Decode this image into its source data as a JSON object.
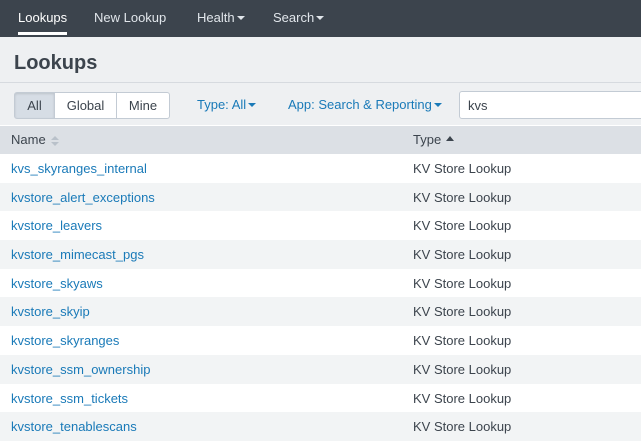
{
  "nav": {
    "items": [
      {
        "label": "Lookups"
      },
      {
        "label": "New Lookup"
      },
      {
        "label": "Health"
      },
      {
        "label": "Search"
      }
    ]
  },
  "page": {
    "title": "Lookups"
  },
  "filters": {
    "scope": [
      "All",
      "Global",
      "Mine"
    ],
    "scope_selected": "All",
    "type_label": "Type: All",
    "app_label": "App: Search & Reporting",
    "search_value": "kvs"
  },
  "table": {
    "columns": [
      {
        "label": "Name",
        "sort": "none"
      },
      {
        "label": "Type",
        "sort": "ascending"
      }
    ],
    "rows": [
      {
        "name": "kvs_skyranges_internal",
        "type": "KV Store Lookup"
      },
      {
        "name": "kvstore_alert_exceptions",
        "type": "KV Store Lookup"
      },
      {
        "name": "kvstore_leavers",
        "type": "KV Store Lookup"
      },
      {
        "name": "kvstore_mimecast_pgs",
        "type": "KV Store Lookup"
      },
      {
        "name": "kvstore_skyaws",
        "type": "KV Store Lookup"
      },
      {
        "name": "kvstore_skyip",
        "type": "KV Store Lookup"
      },
      {
        "name": "kvstore_skyranges",
        "type": "KV Store Lookup"
      },
      {
        "name": "kvstore_ssm_ownership",
        "type": "KV Store Lookup"
      },
      {
        "name": "kvstore_ssm_tickets",
        "type": "KV Store Lookup"
      },
      {
        "name": "kvstore_tenablescans",
        "type": "KV Store Lookup"
      }
    ]
  },
  "colors": {
    "navbar": "#3c444d",
    "header_band": "#eef0f2",
    "link": "#1a7ab8",
    "table_header": "#dce0e5",
    "row_stripe": "#f2f4f5"
  }
}
